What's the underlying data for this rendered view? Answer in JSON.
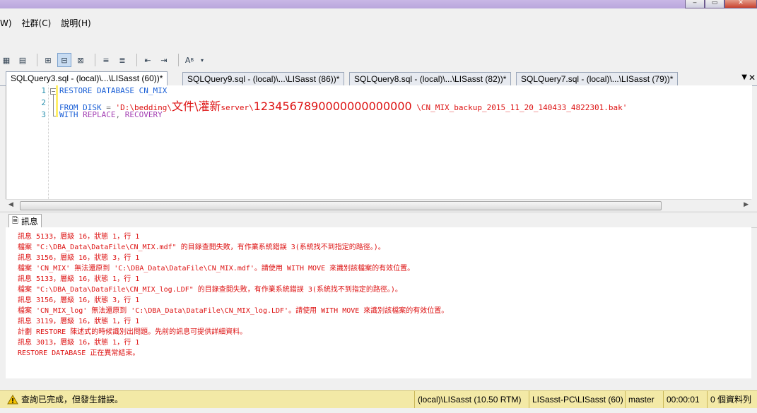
{
  "menu": {
    "items": [
      "W)",
      "社群(C)",
      "說明(H)"
    ]
  },
  "tabs": [
    {
      "label": "SQLQuery3.sql - (local)\\...\\LISasst (60))*",
      "active": true
    },
    {
      "label": "SQLQuery9.sql - (local)\\...\\LISasst (86))*",
      "active": false
    },
    {
      "label": "SQLQuery8.sql - (local)\\...\\LISasst (82))*",
      "active": false
    },
    {
      "label": "SQLQuery7.sql - (local)\\...\\LISasst (79))*",
      "active": false
    }
  ],
  "editor": {
    "line_numbers": [
      "1",
      "2",
      "3"
    ],
    "line1": {
      "kw": "RESTORE DATABASE",
      "name": " CN_MIX"
    },
    "line2": {
      "kw": "FROM DISK",
      "eq": " = ",
      "str_a": "'D:\\bedding\\",
      "str_b": "文件\\灌新",
      "str_c": "server\\",
      "str_d": "1234567890000000000000",
      "str_e": " \\CN_MIX_backup_2015_11_20_140433_4822301.bak'"
    },
    "line3": {
      "kw": "WITH",
      "sys_a": " REPLACE",
      "comma": ", ",
      "sys_b": "RECOVERY"
    }
  },
  "messages_tab": {
    "label": "訊息"
  },
  "messages": [
    "訊息 5133，層級 16，狀態 1，行 1",
    "檔案 \"C:\\DBA_Data\\DataFile\\CN_MIX.mdf\" 的目錄查閱失敗，有作業系統錯誤 3(系統找不到指定的路徑。)。",
    "訊息 3156，層級 16，狀態 3，行 1",
    "檔案 'CN_MIX' 無法還原到 'C:\\DBA_Data\\DataFile\\CN_MIX.mdf'。請使用 WITH MOVE 來識別該檔案的有效位置。",
    "訊息 5133，層級 16，狀態 1，行 1",
    "檔案 \"C:\\DBA_Data\\DataFile\\CN_MIX_log.LDF\" 的目錄查閱失敗，有作業系統錯誤 3(系統找不到指定的路徑。)。",
    "訊息 3156，層級 16，狀態 3，行 1",
    "檔案 'CN_MIX_log' 無法還原到 'C:\\DBA_Data\\DataFile\\CN_MIX_log.LDF'。請使用 WITH MOVE 來識別該檔案的有效位置。",
    "訊息 3119，層級 16，狀態 1，行 1",
    "計劃 RESTORE 陳述式的時候識別出問題。先前的訊息可提供詳細資料。",
    "訊息 3013，層級 16，狀態 1，行 1",
    "RESTORE DATABASE 正在異常結束。"
  ],
  "status": {
    "text": "查詢已完成，但發生錯誤。",
    "server": "(local)\\LISasst (10.50 RTM)",
    "user": "LISasst-PC\\LISasst (60)",
    "database": "master",
    "elapsed": "00:00:01",
    "rows": "0 個資料列"
  },
  "colors": {
    "error_text": "#dd1111",
    "keyword": "#1a5fd6",
    "status_bg": "#f3e9a6"
  }
}
